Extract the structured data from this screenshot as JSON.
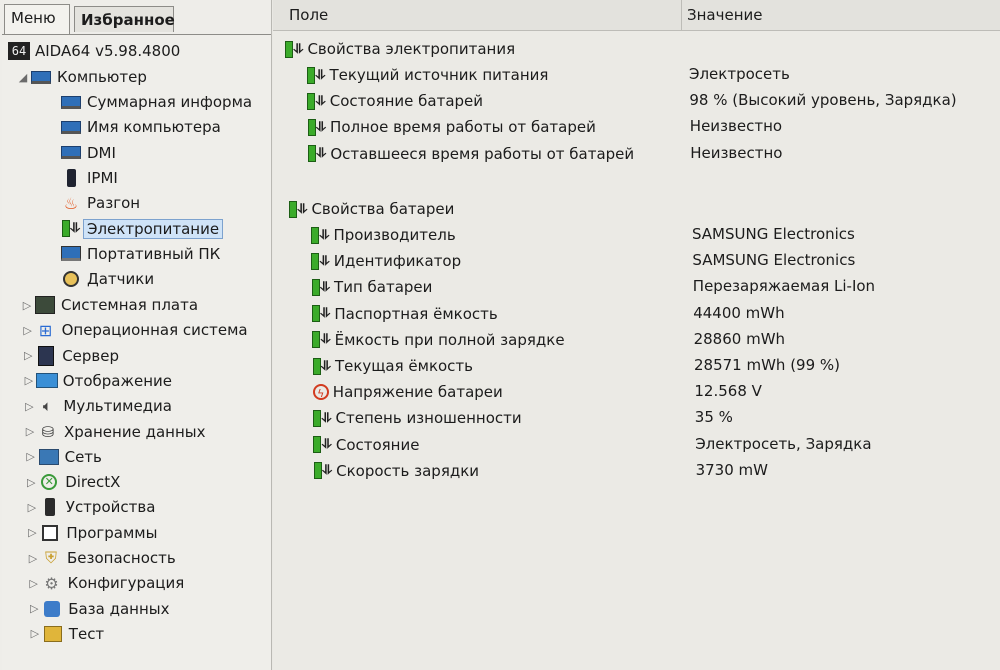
{
  "tabs": {
    "menu": "Меню",
    "favorites": "Избранное"
  },
  "tree": {
    "root": "AIDA64 v5.98.4800",
    "computer": "Компьютер",
    "computer_children": [
      {
        "label": "Суммарная информа",
        "icon": "monitor-icon"
      },
      {
        "label": "Имя компьютера",
        "icon": "monitor-icon"
      },
      {
        "label": "DMI",
        "icon": "monitor-icon"
      },
      {
        "label": "IPMI",
        "icon": "phone-icon"
      },
      {
        "label": "Разгон",
        "icon": "flame-icon"
      },
      {
        "label": "Электропитание",
        "icon": "battery-icon"
      },
      {
        "label": "Портативный ПК",
        "icon": "laptop-icon"
      },
      {
        "label": "Датчики",
        "icon": "gauge-icon"
      }
    ],
    "categories": [
      {
        "label": "Системная плата",
        "icon": "motherboard-icon"
      },
      {
        "label": "Операционная система",
        "icon": "windows-icon"
      },
      {
        "label": "Сервер",
        "icon": "server-icon"
      },
      {
        "label": "Отображение",
        "icon": "display-icon"
      },
      {
        "label": "Мультимедиа",
        "icon": "speaker-icon"
      },
      {
        "label": "Хранение данных",
        "icon": "storage-icon"
      },
      {
        "label": "Сеть",
        "icon": "network-icon"
      },
      {
        "label": "DirectX",
        "icon": "directx-icon"
      },
      {
        "label": "Устройства",
        "icon": "devices-icon"
      },
      {
        "label": "Программы",
        "icon": "programs-icon"
      },
      {
        "label": "Безопасность",
        "icon": "shield-icon"
      },
      {
        "label": "Конфигурация",
        "icon": "config-icon"
      },
      {
        "label": "База данных",
        "icon": "database-icon"
      },
      {
        "label": "Тест",
        "icon": "test-icon"
      }
    ]
  },
  "columns": {
    "field": "Поле",
    "value": "Значение"
  },
  "groups": [
    {
      "title": "Свойства электропитания",
      "rows": [
        {
          "field": "Текущий источник питания",
          "value": "Электросеть"
        },
        {
          "field": "Состояние батарей",
          "value": "98 % (Высокий уровень, Зарядка)"
        },
        {
          "field": "Полное время работы от батарей",
          "value": "Неизвестно"
        },
        {
          "field": "Оставшееся время работы от батарей",
          "value": "Неизвестно"
        }
      ]
    },
    {
      "title": "Свойства батареи",
      "rows": [
        {
          "field": "Производитель",
          "value": "SAMSUNG Electronics"
        },
        {
          "field": "Идентификатор",
          "value": "SAMSUNG Electronics"
        },
        {
          "field": "Тип батареи",
          "value": "Перезаряжаемая Li-Ion"
        },
        {
          "field": "Паспортная ёмкость",
          "value": "44400 mWh"
        },
        {
          "field": "Ёмкость при полной зарядке",
          "value": "28860 mWh"
        },
        {
          "field": "Текущая ёмкость",
          "value": "28571 mWh  (99 %)"
        },
        {
          "field": "Напряжение батареи",
          "value": "12.568 V"
        },
        {
          "field": "Степень изношенности",
          "value": "35 %"
        },
        {
          "field": "Состояние",
          "value": "Электросеть, Зарядка"
        },
        {
          "field": "Скорость зарядки",
          "value": "3730 mW"
        }
      ]
    }
  ],
  "colors": {
    "selection": "#cfe3f7",
    "battery_green": "#3bab2a"
  }
}
